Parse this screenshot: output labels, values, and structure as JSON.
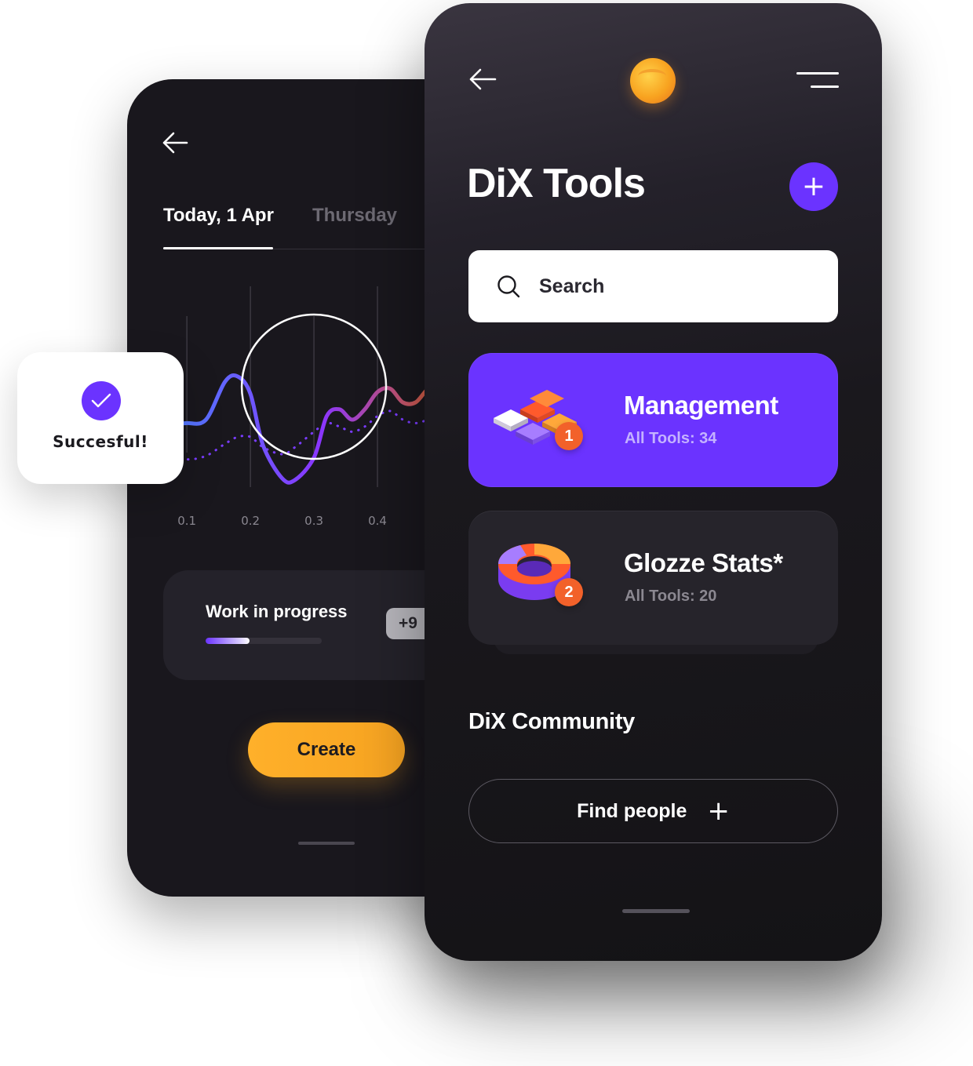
{
  "back_screen": {
    "tabs": [
      {
        "label": "Today, 1 Apr",
        "active": true
      },
      {
        "label": "Thursday",
        "active": false
      }
    ],
    "work_card": {
      "title": "Work in progress",
      "progress_percent": 38,
      "badge": "+9"
    },
    "create_label": "Create"
  },
  "chart_data": {
    "type": "line",
    "x_ticks": [
      "0.1",
      "0.2",
      "0.3",
      "0.4"
    ],
    "grid": true,
    "series": [
      {
        "style": "solid",
        "x": [
          0.08,
          0.1,
          0.13,
          0.16,
          0.18,
          0.2,
          0.22,
          0.25,
          0.27,
          0.3,
          0.32,
          0.34,
          0.36,
          0.38,
          0.4,
          0.42,
          0.44,
          0.46,
          0.48,
          0.5
        ],
        "y": [
          0.38,
          0.38,
          0.4,
          0.62,
          0.65,
          0.55,
          0.25,
          0.06,
          0.05,
          0.18,
          0.42,
          0.46,
          0.4,
          0.46,
          0.56,
          0.58,
          0.5,
          0.5,
          0.58,
          0.6
        ]
      },
      {
        "style": "dotted",
        "x": [
          0.08,
          0.1,
          0.13,
          0.16,
          0.18,
          0.2,
          0.22,
          0.25,
          0.27,
          0.3,
          0.32,
          0.34,
          0.36,
          0.38,
          0.4,
          0.42,
          0.44,
          0.46,
          0.48,
          0.5
        ],
        "y": [
          0.2,
          0.17,
          0.19,
          0.26,
          0.3,
          0.3,
          0.24,
          0.2,
          0.24,
          0.33,
          0.38,
          0.36,
          0.33,
          0.36,
          0.42,
          0.45,
          0.4,
          0.38,
          0.4,
          0.42
        ]
      }
    ],
    "highlight_x": 0.3,
    "colors": {
      "start": "#4f7cff",
      "mid": "#8a35ff",
      "end": "#e0642a"
    }
  },
  "toast": {
    "text": "Succesful!",
    "icon": "check-icon",
    "color": "#6b33ff"
  },
  "front_screen": {
    "title": "DiX Tools",
    "search": {
      "placeholder": "Search",
      "value": ""
    },
    "tools": [
      {
        "name": "Management",
        "subtitle": "All Tools: 34",
        "number": "1",
        "icon": "puzzle-blocks-icon",
        "color": "#6b33ff"
      },
      {
        "name": "Glozze Stats*",
        "subtitle": "All Tools: 20",
        "number": "2",
        "icon": "donut-chart-icon",
        "color": "#26242b"
      }
    ],
    "community": {
      "title": "DiX Community",
      "find_label": "Find people",
      "find_icon": "+"
    }
  },
  "colors": {
    "accent": "#6b33ff",
    "create": "#f6a321",
    "badge": "#f2612a"
  }
}
